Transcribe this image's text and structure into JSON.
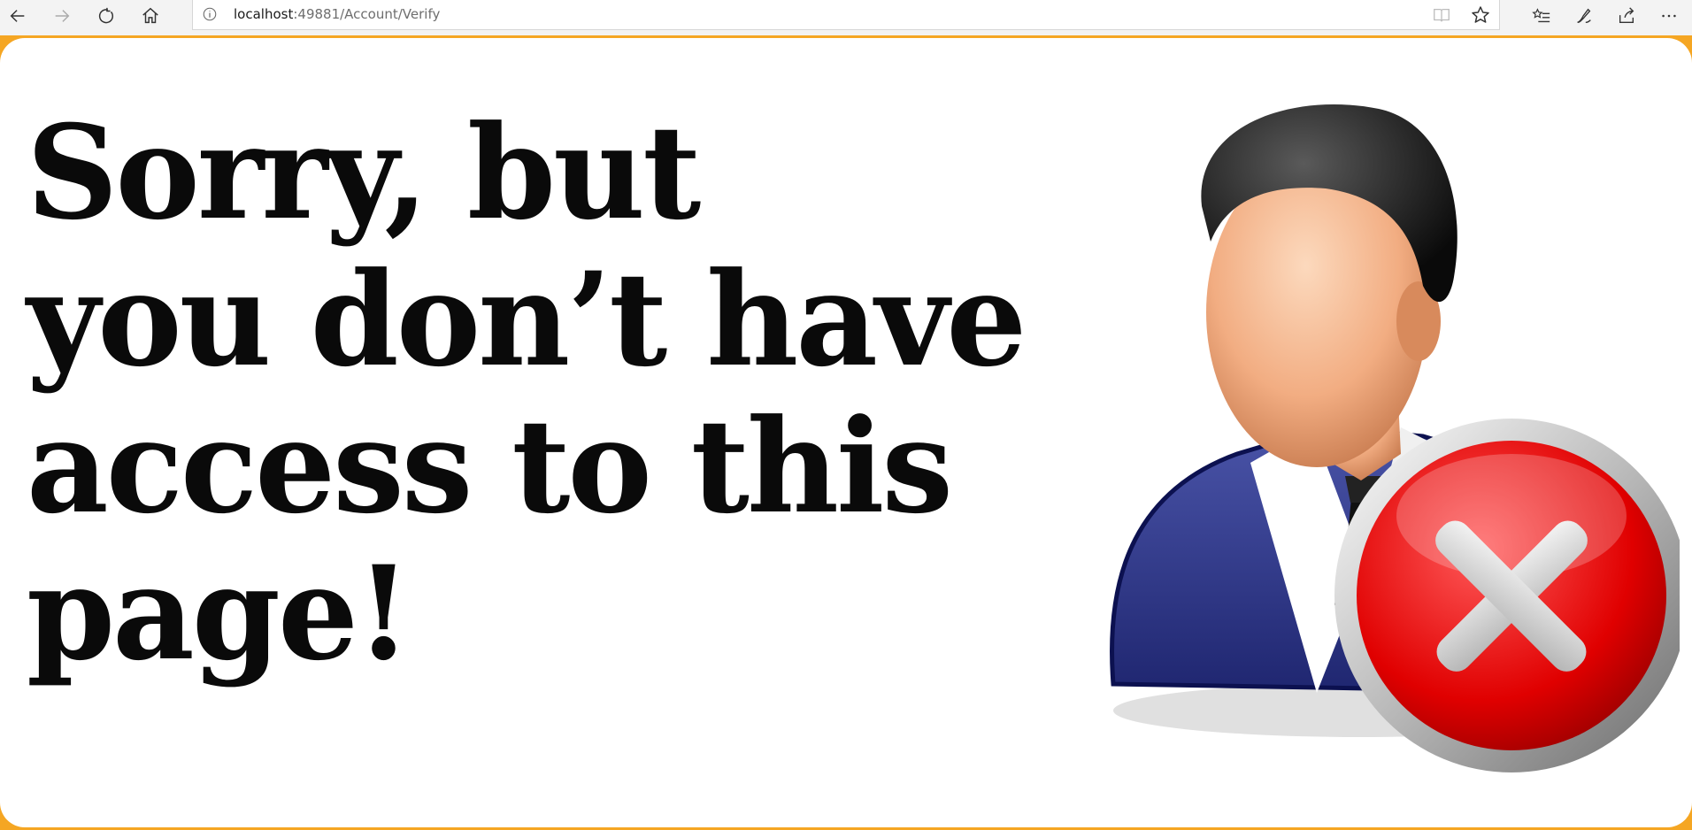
{
  "browser": {
    "url_host": "localhost",
    "url_path": ":49881/Account/Verify",
    "icons": {
      "back": "back-arrow-icon",
      "forward": "forward-arrow-icon",
      "refresh": "refresh-icon",
      "home": "home-icon",
      "info": "info-icon",
      "reading_view": "reading-view-icon",
      "favorite": "star-icon",
      "favorites_hub": "favorites-list-icon",
      "notes": "pen-icon",
      "share": "share-icon",
      "more": "more-icon"
    }
  },
  "page": {
    "headline_lines": [
      "Sorry, but",
      "you don’t have",
      "access to this",
      "page!"
    ],
    "illustration": "access-denied-user-icon",
    "colors": {
      "frame": "#f5a623",
      "background": "#ffffff",
      "text": "#0a0a0a",
      "suit": "#2e3a8c",
      "deny_badge": "#e00000"
    }
  }
}
